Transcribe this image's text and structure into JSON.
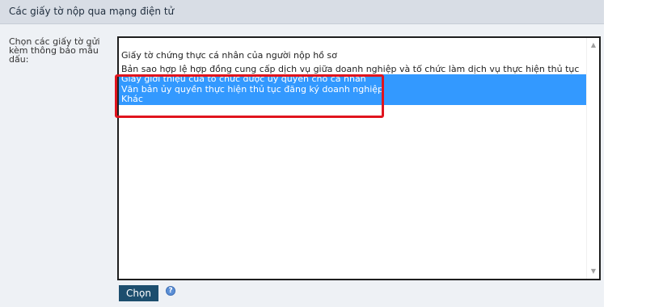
{
  "section": {
    "title": "Các giấy tờ nộp qua mạng điện tử"
  },
  "form": {
    "label_lines": [
      "Chọn các giấy tờ gửi",
      "kèm thông báo mẫu",
      "dấu:"
    ],
    "list_items": [
      {
        "text": "Giấy tờ chứng thực cá nhân của người nộp hồ sơ",
        "selected": false
      },
      {
        "text": "Bản sao hợp lệ hợp đồng cung cấp dịch vụ giữa doanh nghiệp và tổ chức làm dịch vụ thực hiện thủ tục",
        "selected": false
      },
      {
        "text": "Giấy giới thiệu của tổ chức được ủy quyền cho cá nhân",
        "selected": true
      },
      {
        "text": "Văn bản ủy quyền thực hiện thủ tục đăng ký doanh nghiệp",
        "selected": true
      },
      {
        "text": "Khác",
        "selected": true
      }
    ],
    "choose_button": "Chọn",
    "help_glyph": "?"
  },
  "colors": {
    "selection": "#3399ff",
    "highlight_border": "#e0141e",
    "button": "#1d4e6e",
    "header_bg": "#d8dde5",
    "panel_bg": "#eef1f5"
  },
  "icons": {
    "scroll_up": "chevron-up-icon",
    "scroll_down": "chevron-down-icon",
    "help": "help-icon"
  }
}
